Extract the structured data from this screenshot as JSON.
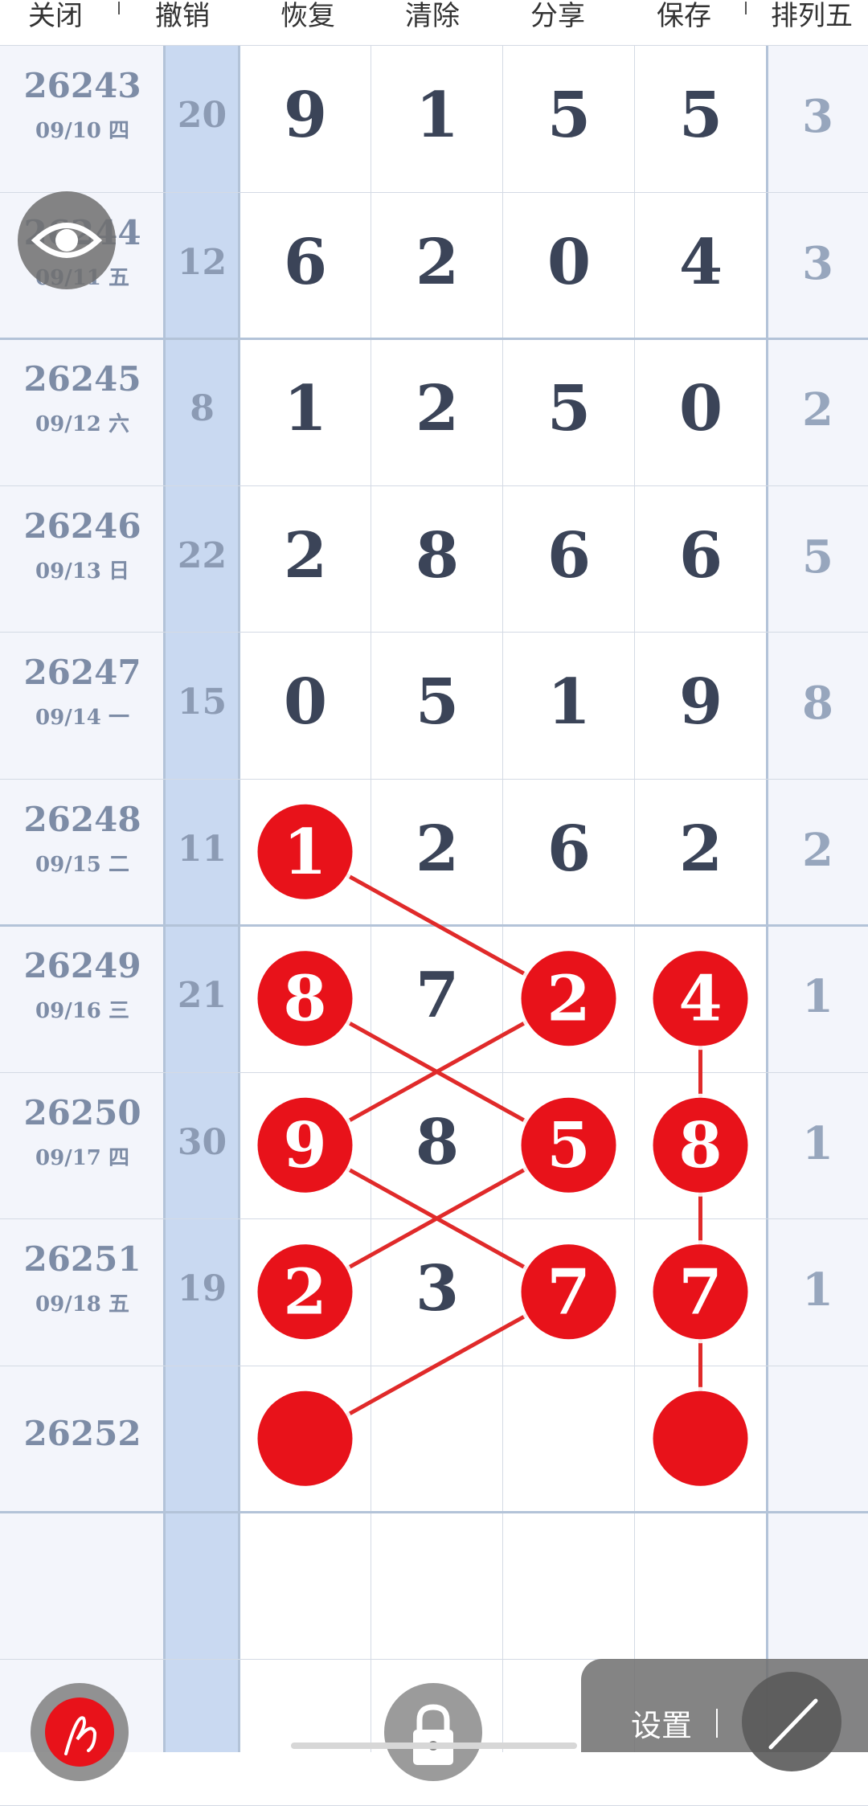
{
  "toolbar": {
    "items": [
      "关闭",
      "撤销",
      "恢复",
      "清除",
      "分享",
      "保存",
      "排列五"
    ]
  },
  "rows": [
    {
      "issue": "26243",
      "date": "09/10 四",
      "sum": "20",
      "nums": [
        "9",
        "1",
        "5",
        "5"
      ],
      "last": "3"
    },
    {
      "issue": "26244",
      "date": "09/11 五",
      "sum": "12",
      "nums": [
        "6",
        "2",
        "0",
        "4"
      ],
      "last": "3"
    },
    {
      "issue": "26245",
      "date": "09/12 六",
      "sum": "8",
      "nums": [
        "1",
        "2",
        "5",
        "0"
      ],
      "last": "2"
    },
    {
      "issue": "26246",
      "date": "09/13 日",
      "sum": "22",
      "nums": [
        "2",
        "8",
        "6",
        "6"
      ],
      "last": "5"
    },
    {
      "issue": "26247",
      "date": "09/14 一",
      "sum": "15",
      "nums": [
        "0",
        "5",
        "1",
        "9"
      ],
      "last": "8"
    },
    {
      "issue": "26248",
      "date": "09/15 二",
      "sum": "11",
      "nums": [
        "1",
        "2",
        "6",
        "2"
      ],
      "last": "2"
    },
    {
      "issue": "26249",
      "date": "09/16 三",
      "sum": "21",
      "nums": [
        "8",
        "7",
        "2",
        "4"
      ],
      "last": "1"
    },
    {
      "issue": "26250",
      "date": "09/17 四",
      "sum": "30",
      "nums": [
        "9",
        "8",
        "5",
        "8"
      ],
      "last": "1"
    },
    {
      "issue": "26251",
      "date": "09/18 五",
      "sum": "19",
      "nums": [
        "2",
        "3",
        "7",
        "7"
      ],
      "last": "1"
    },
    {
      "issue": "26252",
      "date": "",
      "sum": "",
      "nums": [
        "",
        "",
        "",
        ""
      ],
      "last": ""
    }
  ],
  "markers": [
    {
      "row": 5,
      "col": 0
    },
    {
      "row": 6,
      "col": 0
    },
    {
      "row": 7,
      "col": 0
    },
    {
      "row": 8,
      "col": 0
    },
    {
      "row": 9,
      "col": 0
    },
    {
      "row": 6,
      "col": 2
    },
    {
      "row": 7,
      "col": 2
    },
    {
      "row": 8,
      "col": 2
    },
    {
      "row": 6,
      "col": 3
    },
    {
      "row": 7,
      "col": 3
    },
    {
      "row": 8,
      "col": 3
    },
    {
      "row": 9,
      "col": 3
    }
  ],
  "connections": [
    [
      [
        5,
        0
      ],
      [
        6,
        2
      ]
    ],
    [
      [
        6,
        0
      ],
      [
        7,
        2
      ]
    ],
    [
      [
        6,
        2
      ],
      [
        7,
        0
      ]
    ],
    [
      [
        7,
        0
      ],
      [
        8,
        2
      ]
    ],
    [
      [
        7,
        2
      ],
      [
        8,
        0
      ]
    ],
    [
      [
        8,
        2
      ],
      [
        9,
        0
      ]
    ],
    [
      [
        6,
        3
      ],
      [
        7,
        3
      ]
    ],
    [
      [
        7,
        3
      ],
      [
        8,
        3
      ]
    ],
    [
      [
        8,
        3
      ],
      [
        9,
        3
      ]
    ]
  ],
  "settings": {
    "label": "设置"
  },
  "icons": {
    "eye": "eye-icon",
    "pen": "pen-icon",
    "lock": "lock-icon",
    "line_tool": "line-tool-icon"
  },
  "colors": {
    "marker_fill": "#e8121a",
    "line": "#e02a2a",
    "sum_column": "#c9d9f1"
  }
}
